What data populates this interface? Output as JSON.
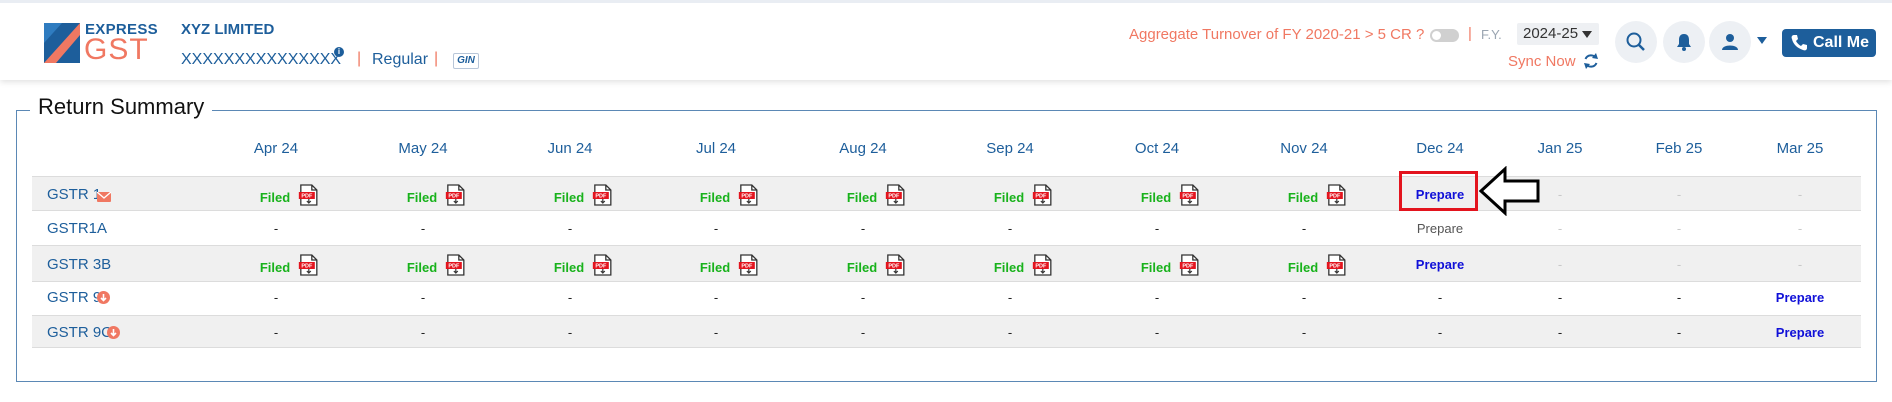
{
  "header": {
    "logo": {
      "line1": "EXPRESS",
      "line2": "GST"
    },
    "company_name": "XYZ LIMITED",
    "gstin": "XXXXXXXXXXXXXXX",
    "info_badge": "i",
    "separator": "|",
    "registration_type": "Regular",
    "gin_badge": "GIN",
    "turnover_question": "Aggregate Turnover of FY 2020-21 > 5 CR ?",
    "turnover_toggle_on": false,
    "fy_label": "F.Y.",
    "fy_value": "2024-25",
    "sync_label": "Sync Now",
    "call_label": "Call Me",
    "icons": [
      "search-icon",
      "bell-icon",
      "user-icon",
      "phone-icon",
      "sync-icon"
    ]
  },
  "summary": {
    "title": "Return Summary",
    "months": [
      "Apr 24",
      "May 24",
      "Jun 24",
      "Jul 24",
      "Aug 24",
      "Sep 24",
      "Oct 24",
      "Nov 24",
      "Dec 24",
      "Jan 25",
      "Feb 25",
      "Mar 25"
    ],
    "rows": [
      {
        "name": "GSTR 1",
        "icon": "mail-icon",
        "cells": [
          "Filed",
          "Filed",
          "Filed",
          "Filed",
          "Filed",
          "Filed",
          "Filed",
          "Filed",
          "Prepare",
          "-",
          "-",
          "-"
        ]
      },
      {
        "name": "GSTR1A",
        "icon": "",
        "cells": [
          "-",
          "-",
          "-",
          "-",
          "-",
          "-",
          "-",
          "-",
          "Prepare",
          "-",
          "-",
          "-"
        ]
      },
      {
        "name": "GSTR 3B",
        "icon": "",
        "cells": [
          "Filed",
          "Filed",
          "Filed",
          "Filed",
          "Filed",
          "Filed",
          "Filed",
          "Filed",
          "Prepare",
          "-",
          "-",
          "-"
        ]
      },
      {
        "name": "GSTR 9",
        "icon": "download-icon",
        "cells": [
          "-",
          "-",
          "-",
          "-",
          "-",
          "-",
          "-",
          "-",
          "-",
          "-",
          "-",
          "Prepare"
        ]
      },
      {
        "name": "GSTR 9C",
        "icon": "download-icon",
        "cells": [
          "-",
          "-",
          "-",
          "-",
          "-",
          "-",
          "-",
          "-",
          "-",
          "-",
          "-",
          "Prepare"
        ]
      }
    ],
    "annotation": "highlight box and arrow around Dec 24 GSTR 1 Prepare",
    "colors": {
      "filed": "#18b21b",
      "prepare": "#1010d8",
      "accent": "#f07862",
      "brand": "#1d5e9b",
      "highlight": "#e3141e"
    }
  }
}
